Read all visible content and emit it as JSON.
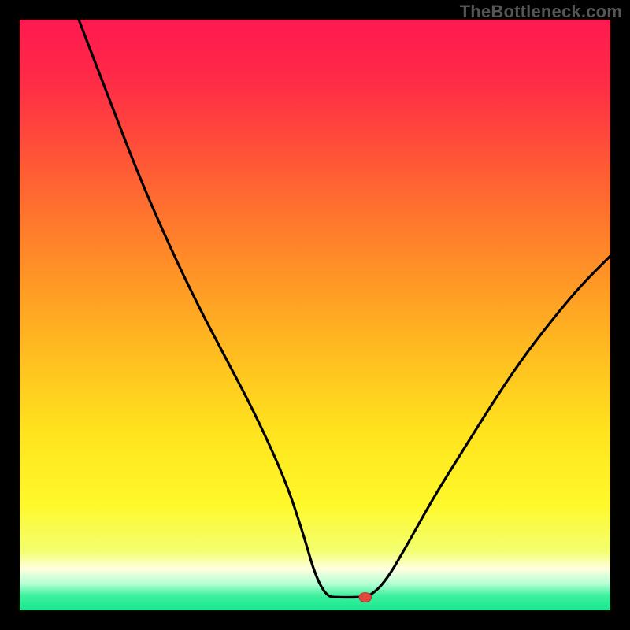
{
  "attribution": "TheBottleneck.com",
  "chart_data": {
    "type": "line",
    "title": "",
    "xlabel": "",
    "ylabel": "",
    "xlim": [
      0,
      100
    ],
    "ylim": [
      0,
      100
    ],
    "curve": [
      {
        "x": 10.0,
        "y": 100.0
      },
      {
        "x": 15.0,
        "y": 87.0
      },
      {
        "x": 20.0,
        "y": 74.0
      },
      {
        "x": 25.0,
        "y": 62.5
      },
      {
        "x": 30.0,
        "y": 52.0
      },
      {
        "x": 35.0,
        "y": 42.5
      },
      {
        "x": 40.0,
        "y": 33.0
      },
      {
        "x": 45.0,
        "y": 22.0
      },
      {
        "x": 48.0,
        "y": 13.0
      },
      {
        "x": 50.0,
        "y": 6.0
      },
      {
        "x": 52.0,
        "y": 2.3
      },
      {
        "x": 54.0,
        "y": 2.2
      },
      {
        "x": 57.5,
        "y": 2.2
      },
      {
        "x": 59.5,
        "y": 2.5
      },
      {
        "x": 62.0,
        "y": 5.0
      },
      {
        "x": 65.0,
        "y": 10.0
      },
      {
        "x": 70.0,
        "y": 19.0
      },
      {
        "x": 75.0,
        "y": 27.0
      },
      {
        "x": 80.0,
        "y": 35.0
      },
      {
        "x": 85.0,
        "y": 42.5
      },
      {
        "x": 90.0,
        "y": 49.0
      },
      {
        "x": 95.0,
        "y": 55.0
      },
      {
        "x": 100.0,
        "y": 60.0
      }
    ],
    "marker": {
      "x": 58.5,
      "y": 2.2
    },
    "gradient_stops": [
      {
        "offset": 0.0,
        "color": "#ff1850"
      },
      {
        "offset": 0.1,
        "color": "#ff2a47"
      },
      {
        "offset": 0.25,
        "color": "#ff5a35"
      },
      {
        "offset": 0.4,
        "color": "#ff8a28"
      },
      {
        "offset": 0.55,
        "color": "#ffb820"
      },
      {
        "offset": 0.7,
        "color": "#ffe41e"
      },
      {
        "offset": 0.82,
        "color": "#fff82a"
      },
      {
        "offset": 0.9,
        "color": "#f3ff70"
      },
      {
        "offset": 0.93,
        "color": "#ffffe0"
      },
      {
        "offset": 0.955,
        "color": "#b4ffd4"
      },
      {
        "offset": 0.975,
        "color": "#3ef09e"
      },
      {
        "offset": 1.0,
        "color": "#18e890"
      }
    ]
  }
}
